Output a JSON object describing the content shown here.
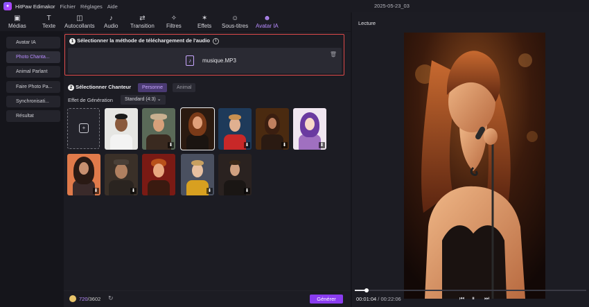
{
  "titlebar": {
    "app_name": "HitPaw Edimakor",
    "menus": [
      "Fichier",
      "Réglages",
      "Aide"
    ],
    "project_title": "2025-05-23_03"
  },
  "toolbar": {
    "tools": [
      {
        "label": "Médias",
        "icon": "media-icon"
      },
      {
        "label": "Texte",
        "icon": "text-icon"
      },
      {
        "label": "Autocollants",
        "icon": "sticker-icon"
      },
      {
        "label": "Audio",
        "icon": "music-note-icon"
      },
      {
        "label": "Transition",
        "icon": "transition-icon"
      },
      {
        "label": "Filtres",
        "icon": "sparkle-icon"
      },
      {
        "label": "Effets",
        "icon": "effects-icon"
      },
      {
        "label": "Sous-titres",
        "icon": "subtitle-icon"
      },
      {
        "label": "Avatar IA",
        "icon": "avatar-icon"
      }
    ],
    "active": "Avatar IA"
  },
  "sidebar": {
    "items": [
      {
        "label": "Avatar IA"
      },
      {
        "label": "Photo Chanta..."
      },
      {
        "label": "Animal Parlant"
      },
      {
        "label": "Faire Photo Pa..."
      },
      {
        "label": "Synchronisati..."
      },
      {
        "label": "Résultat"
      }
    ],
    "active_index": 1
  },
  "main": {
    "step1": {
      "number": "1",
      "title": "Sélectionner la méthode de téléchargement de l'audio",
      "file_name": "musique.MP3"
    },
    "step2": {
      "number": "2",
      "title": "Sélectionner Chanteur",
      "options": [
        "Personne",
        "Animal"
      ],
      "selected": "Personne"
    },
    "effect": {
      "label": "Effet de Génération",
      "value": "Standard (4:3)"
    },
    "credits": {
      "used": "720",
      "total": "/3602"
    },
    "generate_label": "Générer"
  },
  "preview": {
    "title": "Lecture",
    "current_time": "00:01:04",
    "separator": " / ",
    "total_time": "00:22:06",
    "progress": 0.05
  },
  "colors": {
    "accent": "#b88cff",
    "generate": "#8a3cf0",
    "highlight_border": "#e04a4a"
  }
}
